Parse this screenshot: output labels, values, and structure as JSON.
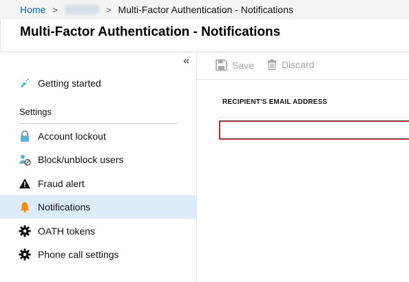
{
  "breadcrumb": {
    "home": "Home",
    "current": "Multi-Factor Authentication - Notifications"
  },
  "page": {
    "title": "Multi-Factor Authentication - Notifications"
  },
  "sidebar": {
    "collapse_icon": "«",
    "getting_started": "Getting started",
    "settings_heading": "Settings",
    "items": [
      {
        "label": "Account lockout",
        "icon": "lock-icon"
      },
      {
        "label": "Block/unblock users",
        "icon": "block-user-icon"
      },
      {
        "label": "Fraud alert",
        "icon": "warning-icon"
      },
      {
        "label": "Notifications",
        "icon": "bell-icon",
        "active": true
      },
      {
        "label": "OATH tokens",
        "icon": "gear-icon"
      },
      {
        "label": "Phone call settings",
        "icon": "gear-icon"
      }
    ]
  },
  "toolbar": {
    "save_label": "Save",
    "discard_label": "Discard"
  },
  "content": {
    "recipient_label": "RECIPIENT'S EMAIL ADDRESS",
    "recipient_value": ""
  },
  "colors": {
    "link": "#0063b1",
    "active_nav": "#dcebfa",
    "error_border": "#d0222b",
    "disabled_text": "#a6a6a6"
  }
}
